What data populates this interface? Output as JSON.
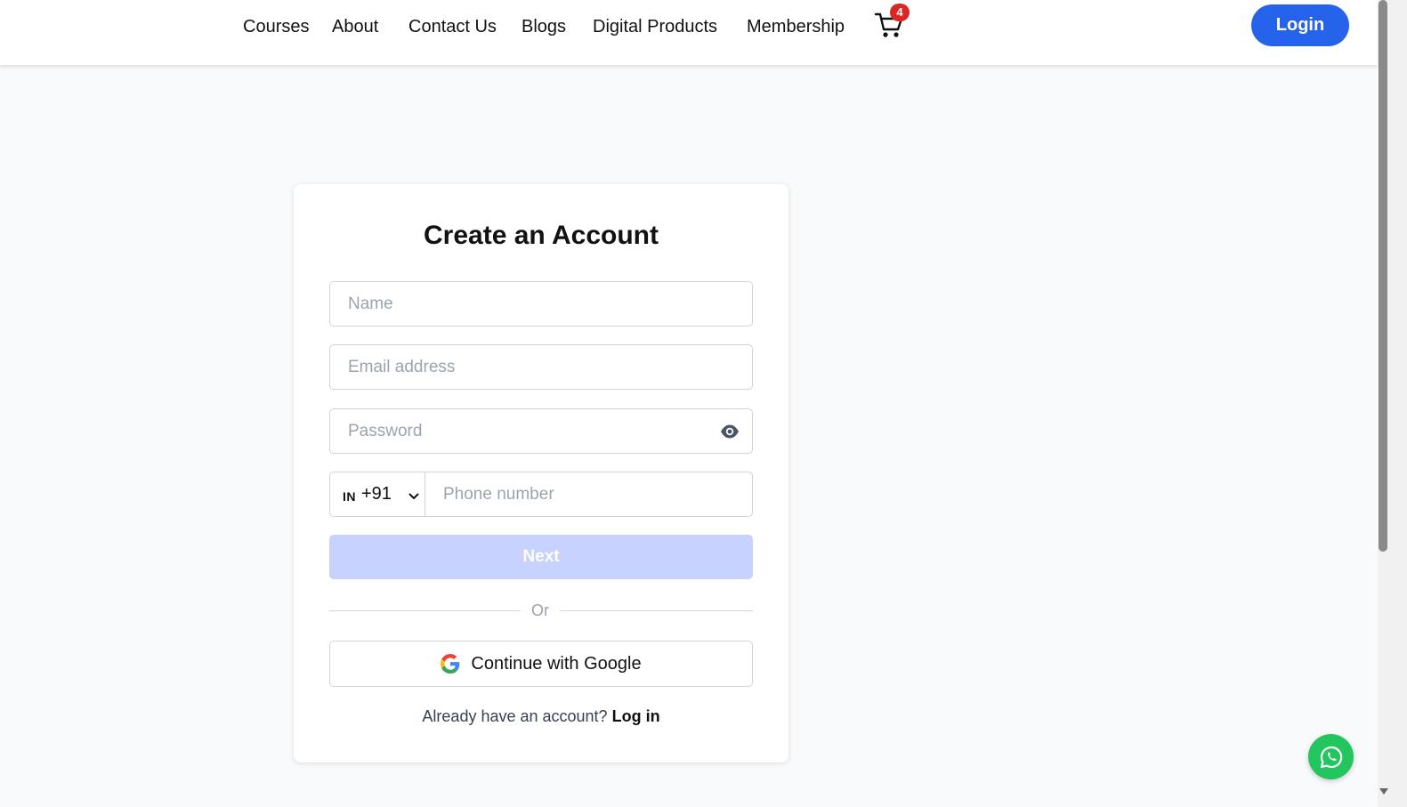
{
  "header": {
    "nav": [
      "Courses",
      "About",
      "Contact Us",
      "Blogs",
      "Digital Products",
      "Membership"
    ],
    "cart_count": "4",
    "login_label": "Login"
  },
  "form": {
    "title": "Create an Account",
    "name_placeholder": "Name",
    "email_placeholder": "Email address",
    "password_placeholder": "Password",
    "country_code": "IN",
    "dial_code": "+91",
    "phone_placeholder": "Phone number",
    "next_label": "Next",
    "or_label": "Or",
    "google_label": "Continue with Google",
    "already_text": "Already have an account?",
    "login_link": "Log in"
  },
  "colors": {
    "accent": "#2563eb",
    "next_disabled": "#c7d2fe",
    "badge": "#dc2626",
    "whatsapp": "#22c55e"
  },
  "icons": [
    "cart-icon",
    "eye-icon",
    "chevron-down-icon",
    "google-icon",
    "whatsapp-icon"
  ]
}
